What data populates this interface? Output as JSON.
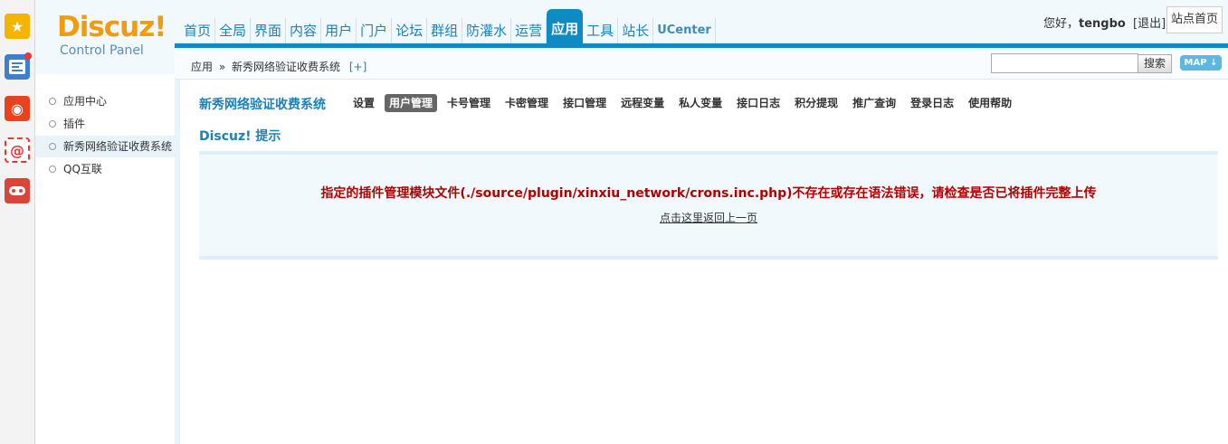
{
  "brand": {
    "name": "Discuz!",
    "subtitle": "Control Panel"
  },
  "nav": {
    "items": [
      {
        "label": "首页"
      },
      {
        "label": "全局"
      },
      {
        "label": "界面"
      },
      {
        "label": "内容"
      },
      {
        "label": "用户"
      },
      {
        "label": "门户"
      },
      {
        "label": "论坛"
      },
      {
        "label": "群组"
      },
      {
        "label": "防灌水"
      },
      {
        "label": "运营"
      },
      {
        "label": "应用",
        "active": true
      },
      {
        "label": "工具"
      },
      {
        "label": "站长"
      },
      {
        "label": "UCenter"
      }
    ]
  },
  "user": {
    "greeting": "您好，",
    "name": "tengbo",
    "logout": "[退出]"
  },
  "home_button": "站点首页",
  "breadcrumb": {
    "root": "应用",
    "sep": "»",
    "current": "新秀网络验证收费系统",
    "add": "[+]"
  },
  "search": {
    "button": "搜索",
    "value": ""
  },
  "map_button": "MAP",
  "sidebar": {
    "items": [
      {
        "label": "应用中心"
      },
      {
        "label": "插件"
      },
      {
        "label": "新秀网络验证收费系统",
        "active": true
      },
      {
        "label": "QQ互联"
      }
    ]
  },
  "app": {
    "title": "新秀网络验证收费系统",
    "tabs": [
      {
        "label": "设置"
      },
      {
        "label": "用户管理",
        "active": true
      },
      {
        "label": "卡号管理"
      },
      {
        "label": "卡密管理"
      },
      {
        "label": "接口管理"
      },
      {
        "label": "远程变量"
      },
      {
        "label": "私人变量"
      },
      {
        "label": "接口日志"
      },
      {
        "label": "积分提现"
      },
      {
        "label": "推广查询"
      },
      {
        "label": "登录日志"
      },
      {
        "label": "使用帮助"
      }
    ]
  },
  "notice": {
    "title": "Discuz! 提示",
    "message": "指定的插件管理模块文件(./source/plugin/xinxiu_network/crons.inc.php)不存在或存在语法错误，请检查是否已将插件完整上传",
    "back_link": "点击这里返回上一页"
  },
  "colors": {
    "accent": "#0f8ac3",
    "error": "#b20000",
    "logo": "#f29b0d"
  },
  "dock_icons": [
    "star-icon",
    "news-icon",
    "weibo-icon",
    "email-icon",
    "game-icon"
  ]
}
